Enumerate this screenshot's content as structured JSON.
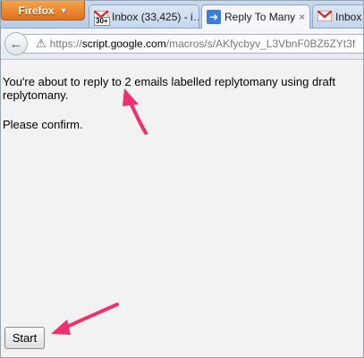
{
  "browser": {
    "menu_button_label": "Firefox",
    "tabs": [
      {
        "title": "Inbox (33,425) - i…",
        "icon": "gmail-icon",
        "badge": "30+"
      },
      {
        "title": "Reply To Many",
        "icon": "apps-script-icon",
        "close": "×"
      },
      {
        "title": "Inbox",
        "icon": "gmail-icon"
      }
    ],
    "url": {
      "scheme": "https://",
      "host": "script.google.com",
      "path": "/macros/s/AKfycbyv_L3VbnF0BZ6ZYt3f"
    }
  },
  "page": {
    "message": "You're about to reply to 2 emails labelled replytomany using draft replytomany.",
    "confirm_text": "Please confirm.",
    "start_label": "Start"
  },
  "colors": {
    "annotation_arrow": "#f0306c",
    "firefox_button": "#e0701c"
  }
}
